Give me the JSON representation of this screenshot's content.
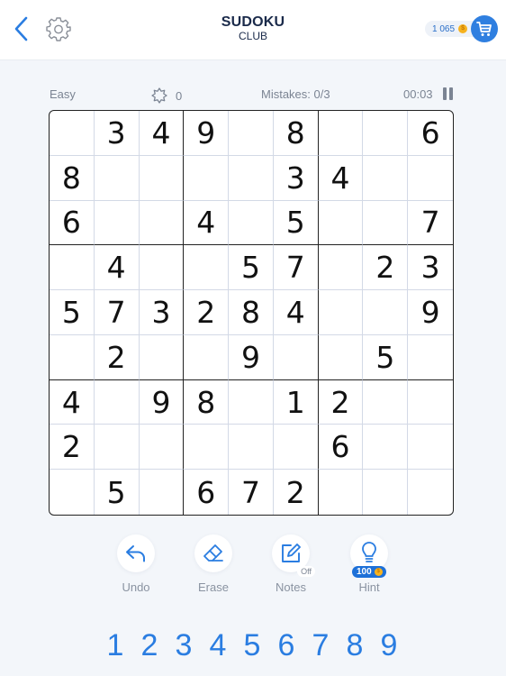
{
  "header": {
    "title": "SUDOKU",
    "subtitle": "CLUB",
    "coins": "1 065",
    "coin_symbol": "$",
    "icons": {
      "back": "chevron-left-icon",
      "settings": "gear-icon",
      "cart": "cart-icon"
    }
  },
  "status": {
    "difficulty": "Easy",
    "score": "0",
    "mistakes": "Mistakes: 0/3",
    "timer": "00:03"
  },
  "grid": [
    [
      "",
      "3",
      "4",
      "9",
      "",
      "8",
      "",
      "",
      "6"
    ],
    [
      "8",
      "",
      "",
      "",
      "",
      "3",
      "4",
      "",
      ""
    ],
    [
      "6",
      "",
      "",
      "4",
      "",
      "5",
      "",
      "",
      "7"
    ],
    [
      "",
      "4",
      "",
      "",
      "5",
      "7",
      "",
      "2",
      "3"
    ],
    [
      "5",
      "7",
      "3",
      "2",
      "8",
      "4",
      "",
      "",
      "9"
    ],
    [
      "",
      "2",
      "",
      "",
      "9",
      "",
      "",
      "5",
      ""
    ],
    [
      "4",
      "",
      "9",
      "8",
      "",
      "1",
      "2",
      "",
      ""
    ],
    [
      "2",
      "",
      "",
      "",
      "",
      "",
      "6",
      "",
      ""
    ],
    [
      "",
      "5",
      "",
      "6",
      "7",
      "2",
      "",
      "",
      ""
    ]
  ],
  "tools": {
    "undo": "Undo",
    "erase": "Erase",
    "notes": "Notes",
    "notes_state": "Off",
    "hint": "Hint",
    "hint_cost": "100"
  },
  "numpad": [
    "1",
    "2",
    "3",
    "4",
    "5",
    "6",
    "7",
    "8",
    "9"
  ],
  "colors": {
    "accent": "#2a7de1",
    "text": "#1a2a4a",
    "muted": "#7b8493",
    "coin": "#f6b21f"
  }
}
